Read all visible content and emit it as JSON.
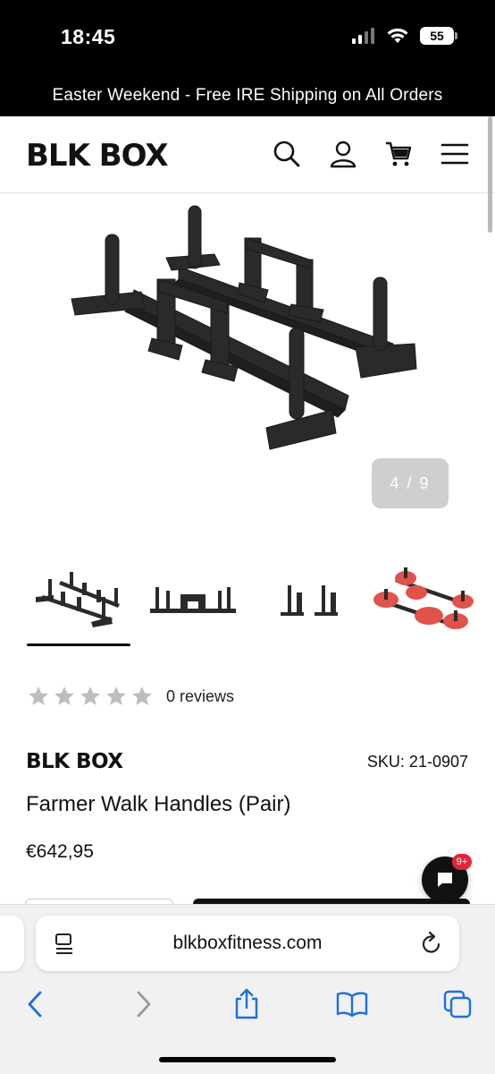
{
  "status_bar": {
    "time": "18:45",
    "battery": "55"
  },
  "promo": {
    "text": "Easter Weekend - Free IRE Shipping on All Orders"
  },
  "header": {
    "logo": "BLK BOX",
    "icons": [
      "search-icon",
      "account-icon",
      "cart-icon",
      "menu-icon"
    ]
  },
  "gallery": {
    "pager": "4 / 9",
    "thumbnails": [
      "thumbnail-1",
      "thumbnail-2",
      "thumbnail-3",
      "thumbnail-4"
    ],
    "active_thumbnail": 1
  },
  "product": {
    "rating_stars": 0,
    "reviews": "0 reviews",
    "brand": "BLK BOX",
    "sku": "SKU: 21-0907",
    "title": "Farmer Walk Handles (Pair)",
    "price": "€642,95"
  },
  "chat": {
    "badge": "9+"
  },
  "browser": {
    "url": "blkboxfitness.com"
  },
  "colors": {
    "accent_black": "#000000",
    "badge_red": "#e32636",
    "plate_red": "#e0524a",
    "star_grey": "#bdbdbd",
    "link_blue": "#1d6fe0"
  }
}
